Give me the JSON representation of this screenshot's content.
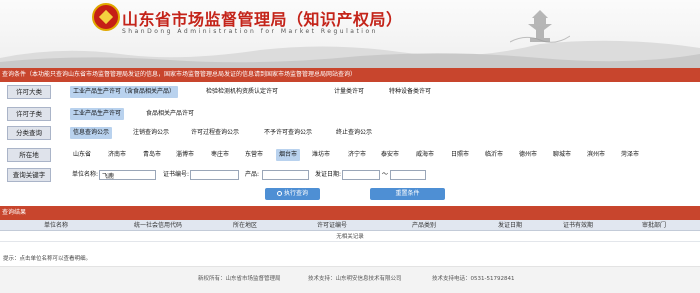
{
  "header": {
    "title": "山东省市场监督管理局（知识产权局）",
    "subtitle": "ShanDong Administration for Market Regulation"
  },
  "notice": "查询条件（本功能只查询山东省市场监督管理局发证的信息，国家市场监督管理总局发证的信息请到国家市场监督管理总局网站查询）",
  "filters": {
    "license_category": {
      "label": "许可大类",
      "options": [
        "工业产品生产许可（含食品相关产品）",
        "检验检测机构资质认定许可",
        "计量类许可",
        "特种设备类许可"
      ],
      "selected": 0
    },
    "license_subcategory": {
      "label": "许可子类",
      "options": [
        "工业产品生产许可",
        "食品相关产品许可"
      ],
      "selected": 0
    },
    "query_type": {
      "label": "分类查询",
      "options": [
        "信息查询公示",
        "注销查询公示",
        "许可过程查询公示",
        "不予许可查询公示",
        "终止查询公示"
      ],
      "selected": 0
    },
    "location": {
      "label": "所在地",
      "options": [
        "山东省",
        "济南市",
        "青岛市",
        "淄博市",
        "枣庄市",
        "东营市",
        "烟台市",
        "潍坊市",
        "济宁市",
        "泰安市",
        "威海市",
        "日照市",
        "临沂市",
        "德州市",
        "聊城市",
        "滨州市",
        "菏泽市"
      ],
      "selected": 6
    }
  },
  "keyword": {
    "label": "查询关键字",
    "company_label": "单位名称:",
    "company_value": "飞鹿",
    "cert_label": "证书编号:",
    "cert_value": "",
    "product_label": "产品:",
    "product_value": "",
    "date_label": "发证日期:",
    "date_from": "",
    "date_sep": "～",
    "date_to": ""
  },
  "buttons": {
    "search": "执行查询",
    "reset": "重置条件"
  },
  "results": {
    "title": "查询结果",
    "columns": [
      "单位名称",
      "统一社会信用代码",
      "所在地区",
      "许可证编号",
      "产品类别",
      "发证日期",
      "证书有效期",
      "审批部门"
    ],
    "empty_text": "无相关记录"
  },
  "hint": "提示：点击单位名称可以查看明细。",
  "footer": {
    "host": "新权所有：山东省市场监督管理局",
    "tech": "技术支持：山东明安信息技术有限公司",
    "phone": "技术支持电话：0531-51792841"
  },
  "colors": {
    "brand_red": "#c4241a",
    "bar_red": "#c8452d",
    "selected_bg": "#b9d2ee",
    "button_blue": "#4e8fd4"
  }
}
